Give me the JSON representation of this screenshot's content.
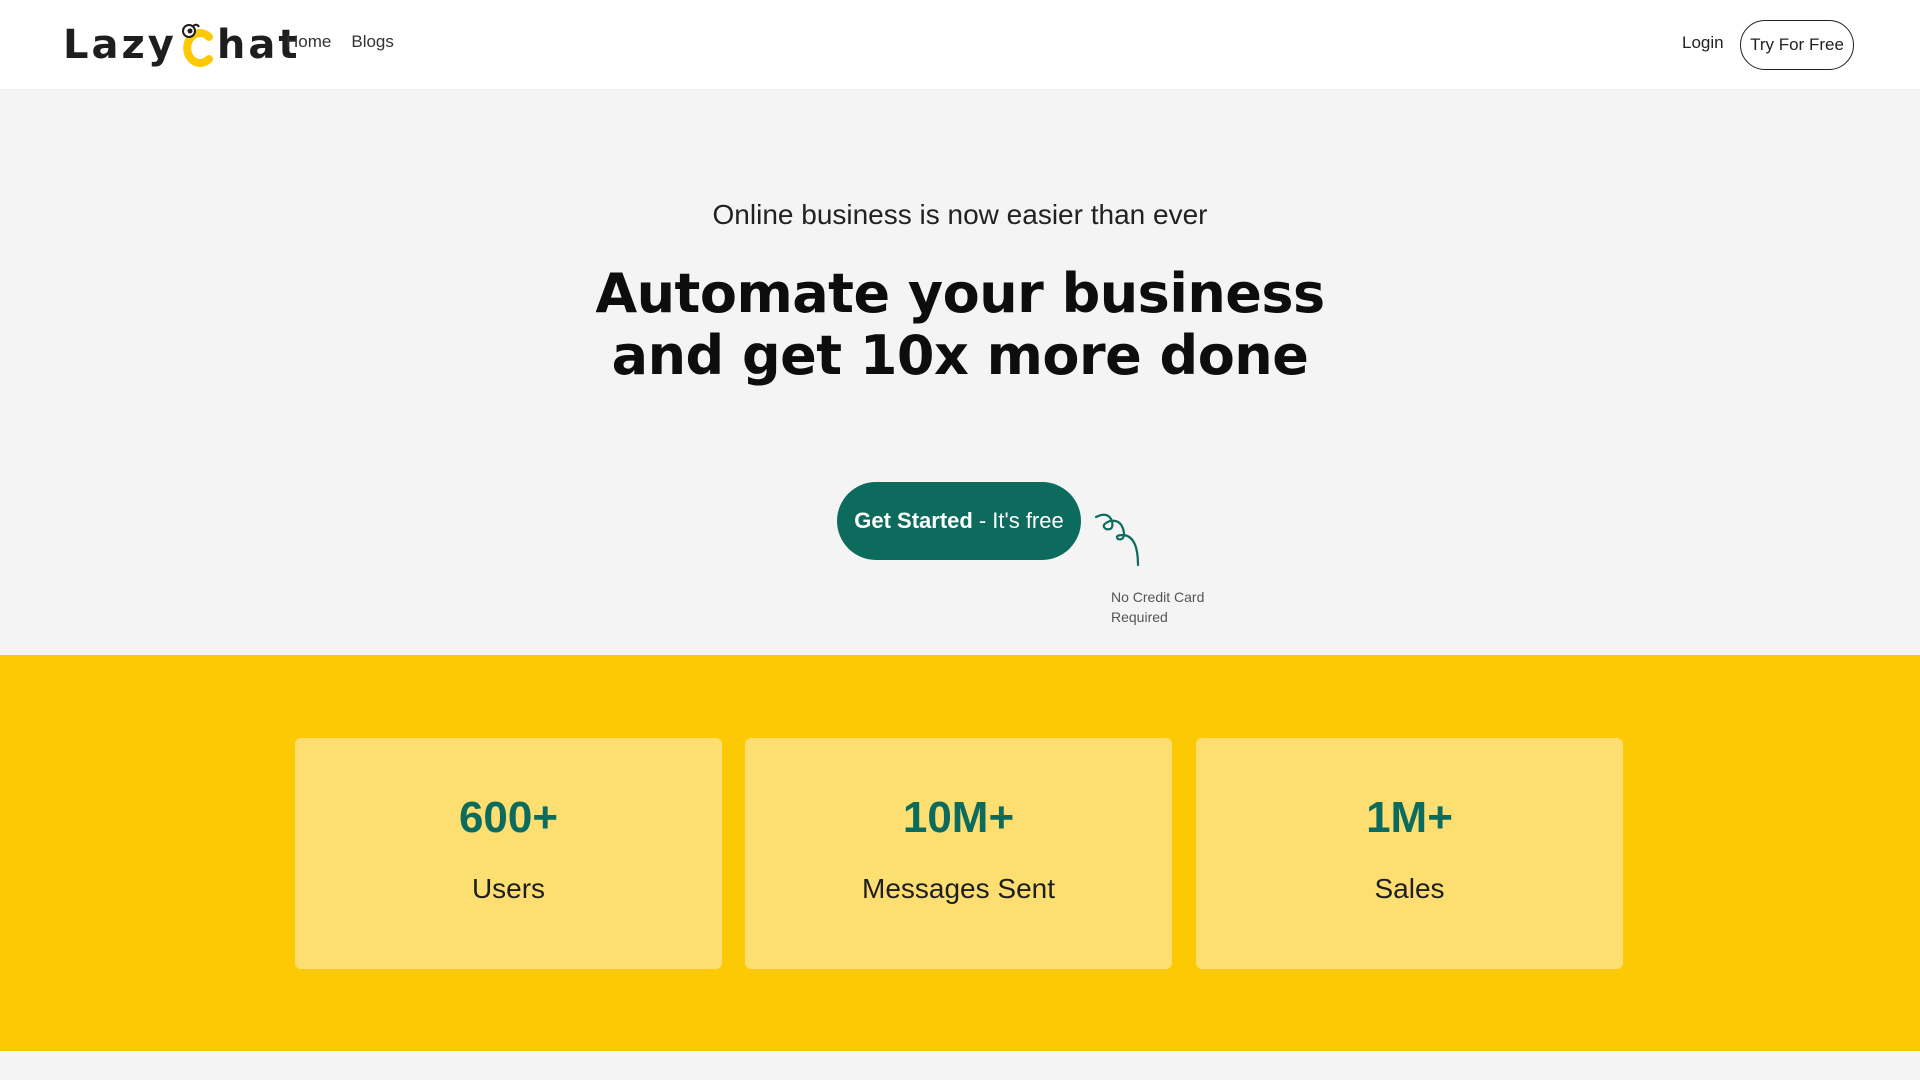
{
  "brand": {
    "name_part1": "Lazy",
    "name_part2": "hat",
    "accent_color": "#fdc904",
    "primary_color": "#0d6b5e"
  },
  "nav": {
    "items": [
      {
        "label": "Home"
      },
      {
        "label": "Blogs"
      }
    ],
    "login_label": "Login",
    "try_label": "Try For Free"
  },
  "hero": {
    "subtitle": "Online business is now easier than ever",
    "title_line1": "Automate your business",
    "title_line2": "and get 10x more done",
    "cta_strong": "Get Started",
    "cta_rest": "- It's free",
    "note_line1": "No Credit Card",
    "note_line2": "Required"
  },
  "stats": [
    {
      "value": "600+",
      "label": "Users"
    },
    {
      "value": "10M+",
      "label": "Messages Sent"
    },
    {
      "value": "1M+",
      "label": "Sales"
    }
  ]
}
